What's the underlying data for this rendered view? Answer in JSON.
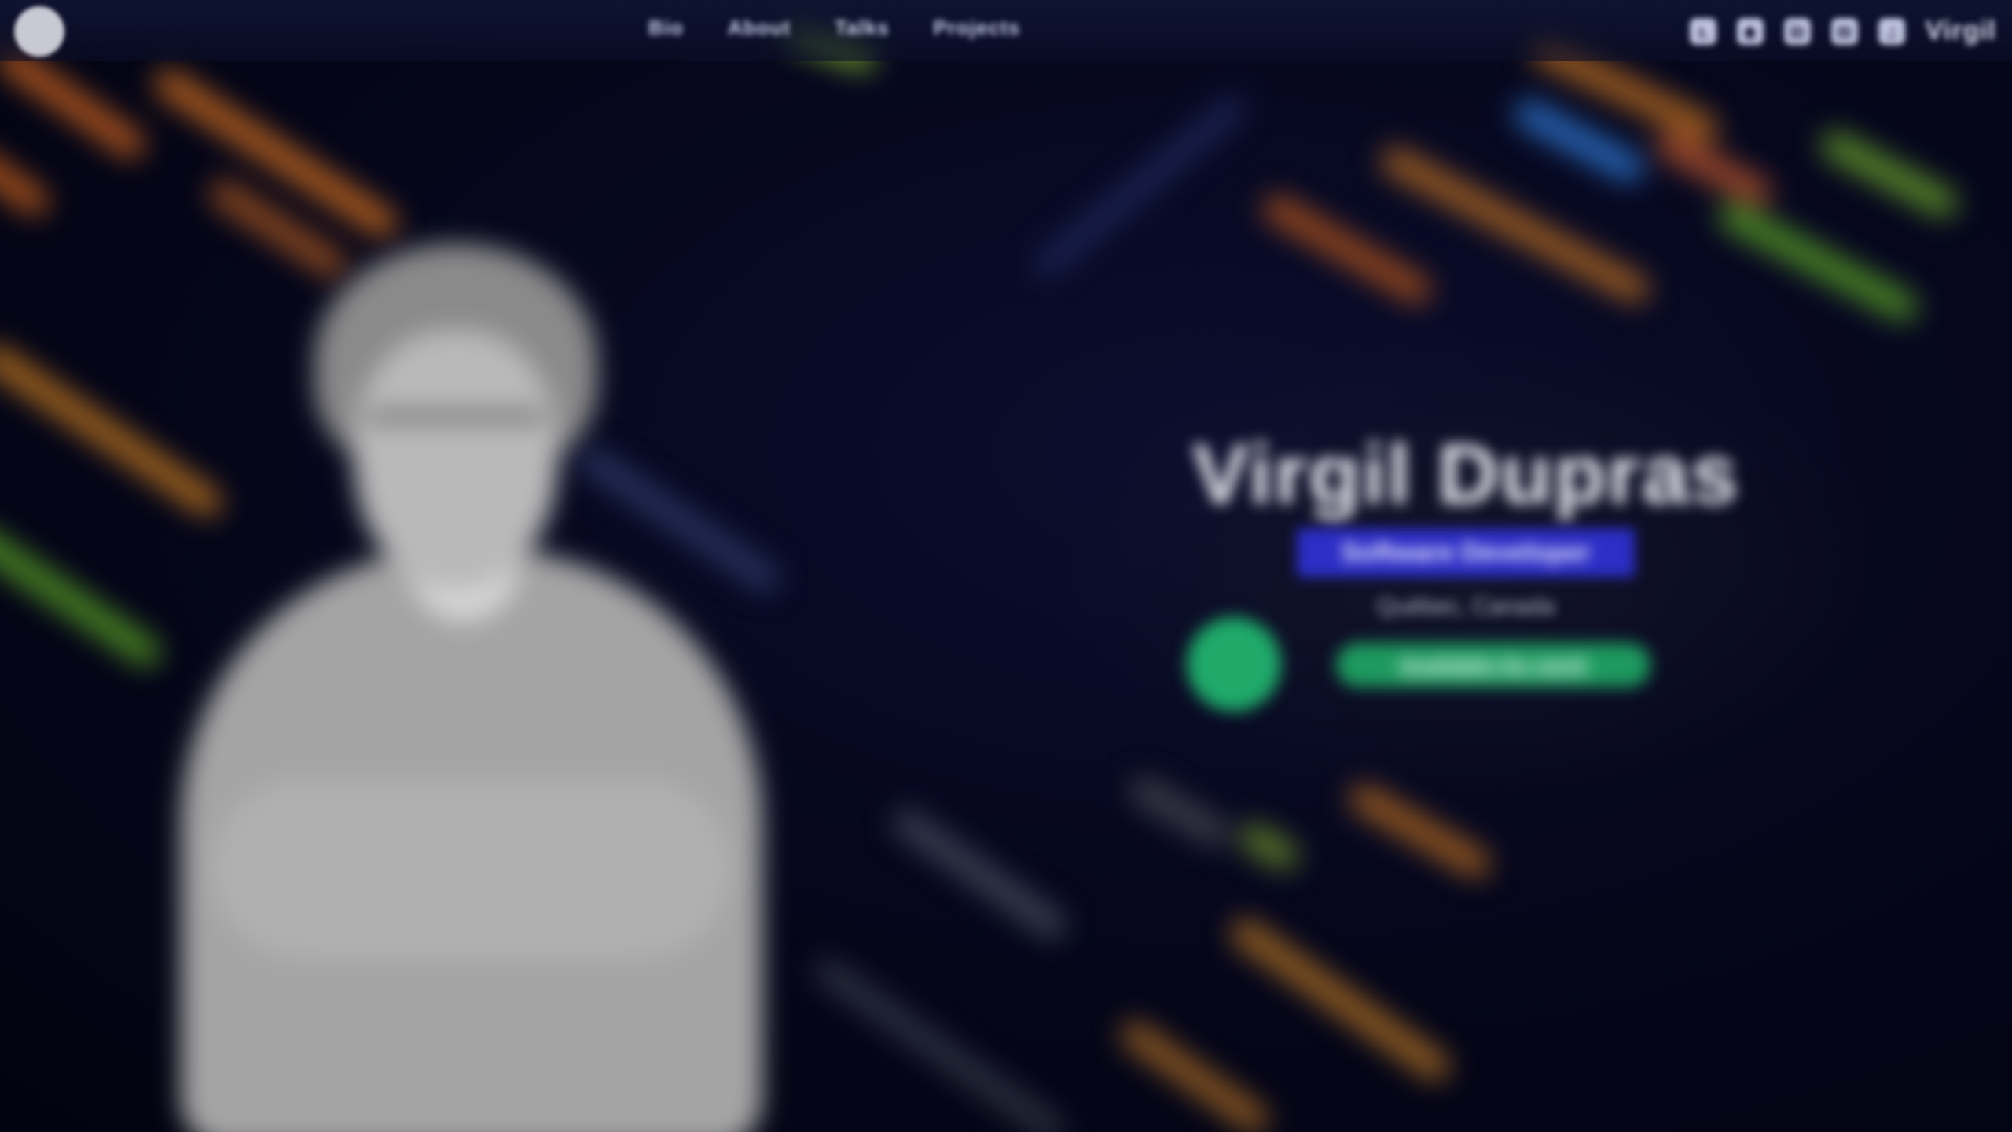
{
  "header": {
    "nav": [
      {
        "label": "Bio"
      },
      {
        "label": "About"
      },
      {
        "label": "Talks"
      },
      {
        "label": "Projects"
      }
    ],
    "social": [
      {
        "icon": "github-icon",
        "glyph": "◐"
      },
      {
        "icon": "twitter-icon",
        "glyph": "◆"
      },
      {
        "icon": "linkedin-icon",
        "glyph": "in"
      },
      {
        "icon": "mastodon-icon",
        "glyph": "m"
      },
      {
        "icon": "rss-icon",
        "glyph": "◔"
      }
    ],
    "wordmark": "Virgil"
  },
  "hero": {
    "name": "Virgil Dupras",
    "title": "Software Developer",
    "location": "Québec, Canada",
    "status": "Available for work"
  },
  "colors": {
    "background": "#05061a",
    "accent": "#2c2ec6",
    "status": "#1faa6a"
  }
}
